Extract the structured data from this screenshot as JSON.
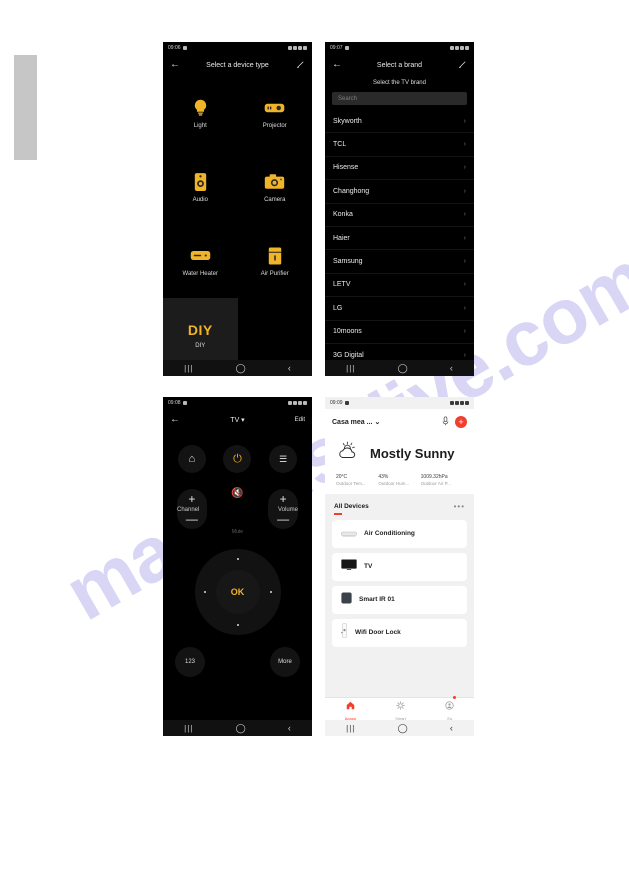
{
  "watermark": "manualsalive.com",
  "phone1": {
    "status": {
      "time": "09:06",
      "signal": "▮▮▯ ▮"
    },
    "header": {
      "back": "←",
      "title": "Select a device type",
      "edit_icon": "pencil-icon"
    },
    "tiles": [
      {
        "label": "Light",
        "icon": "light-bulb-icon",
        "selected": false
      },
      {
        "label": "Projector",
        "icon": "projector-icon",
        "selected": false
      },
      {
        "label": "Audio",
        "icon": "audio-speaker-icon",
        "selected": false
      },
      {
        "label": "Camera",
        "icon": "camera-icon",
        "selected": false
      },
      {
        "label": "Water Heater",
        "icon": "water-heater-icon",
        "selected": false
      },
      {
        "label": "Air Purifier",
        "icon": "air-purifier-icon",
        "selected": false
      },
      {
        "label": "DIY",
        "icon": "diy-text-icon",
        "selected": true
      },
      {
        "label": "",
        "icon": "",
        "selected": false
      }
    ],
    "diy_glyph": "DIY",
    "nav": {
      "recents": "|||",
      "home": "◯",
      "back": "‹"
    }
  },
  "phone2": {
    "status": {
      "time": "09:07"
    },
    "header": {
      "back": "←",
      "title": "Select a brand",
      "edit_icon": "pencil-icon"
    },
    "subtitle": "Select the TV brand",
    "search_placeholder": "Search",
    "brands": [
      "Skyworth",
      "TCL",
      "Hisense",
      "Changhong",
      "Konka",
      "Haier",
      "Samsung",
      "LETV",
      "LG",
      "10moons",
      "3G Digital"
    ],
    "chevron": "›",
    "nav": {
      "recents": "|||",
      "home": "◯",
      "back": "‹"
    }
  },
  "phone3": {
    "status": {
      "time": "09:08"
    },
    "header": {
      "back": "←",
      "title": "TV ▾",
      "edit_label": "Edit"
    },
    "top_buttons": [
      {
        "name": "home-button",
        "glyph": "⌂"
      },
      {
        "name": "power-button",
        "glyph": "⏻"
      },
      {
        "name": "menu-button",
        "glyph": "☰"
      }
    ],
    "channel": {
      "label": "Channel",
      "plus": "+",
      "minus": "—"
    },
    "volume": {
      "label": "Volume",
      "plus": "+",
      "minus": "—"
    },
    "mute": {
      "glyph": "🔇",
      "label": "Mute"
    },
    "ok_label": "OK",
    "num_label": "123",
    "more_label": "More",
    "nav": {
      "recents": "|||",
      "home": "◯",
      "back": "‹"
    }
  },
  "phone4": {
    "status": {
      "time": "09:09"
    },
    "home_name": "Casa mea ...",
    "chevron_down": "⌄",
    "mic_icon": "microphone-icon",
    "add_label": "+",
    "weather": {
      "condition": "Mostly Sunny",
      "icon": "sun-cloud-icon",
      "stats": [
        {
          "value": "20°C",
          "label": "Outdoor Tem..."
        },
        {
          "value": "43%",
          "label": "Outdoor Hum..."
        },
        {
          "value": "1009.32hPa",
          "label": "Outdoor Air P..."
        }
      ]
    },
    "all_devices_label": "All Devices",
    "more_dots": "•••",
    "devices": [
      {
        "name": "Air Conditioning",
        "icon": "air-conditioner-icon"
      },
      {
        "name": "TV",
        "icon": "television-icon"
      },
      {
        "name": "Smart IR 01",
        "icon": "ir-blaster-icon"
      },
      {
        "name": "Wifi Door Lock",
        "icon": "door-lock-icon"
      }
    ],
    "tabs": [
      {
        "label": "Acasa",
        "icon": "home-icon",
        "active": true,
        "badge": false
      },
      {
        "label": "Smart",
        "icon": "smart-icon",
        "active": false,
        "badge": false
      },
      {
        "label": "Eu",
        "icon": "profile-icon",
        "active": false,
        "badge": true
      }
    ],
    "nav": {
      "recents": "|||",
      "home": "◯",
      "back": "‹"
    }
  }
}
